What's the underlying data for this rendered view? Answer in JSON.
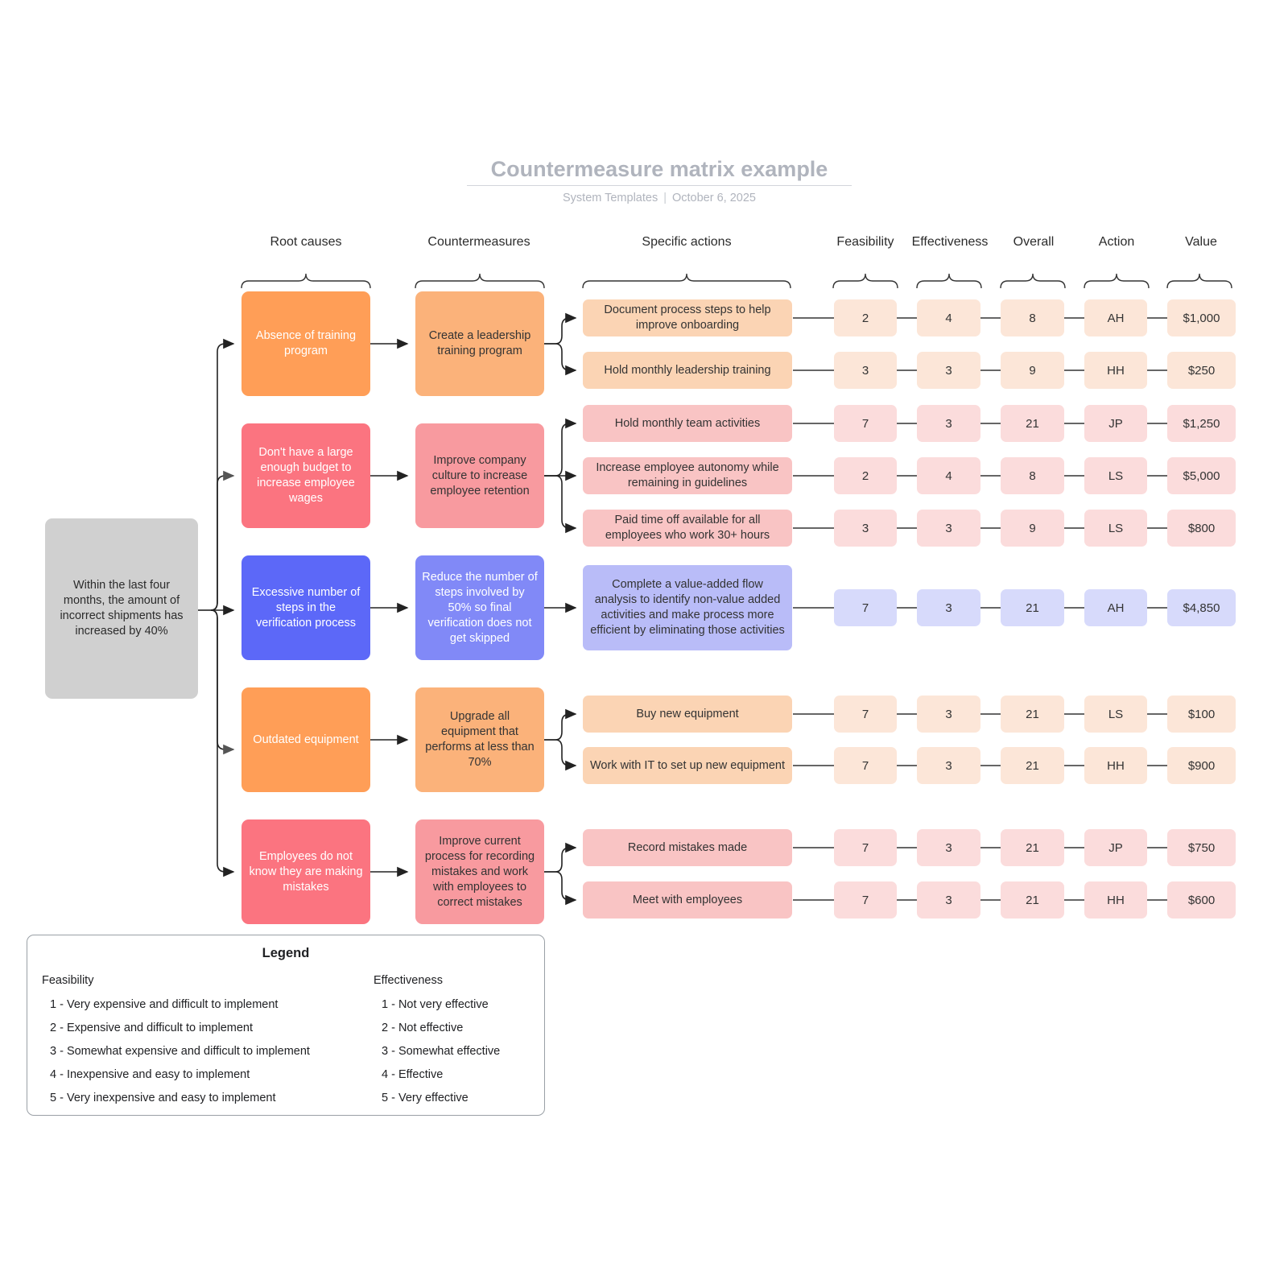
{
  "header": {
    "title": "Countermeasure matrix example",
    "author": "System Templates",
    "separator": "|",
    "date": "October 6, 2025"
  },
  "columns": [
    {
      "key": "root_causes",
      "label": "Root causes"
    },
    {
      "key": "countermeasures",
      "label": "Countermeasures"
    },
    {
      "key": "specific_actions",
      "label": "Specific actions"
    },
    {
      "key": "feasibility",
      "label": "Feasibility"
    },
    {
      "key": "effectiveness",
      "label": "Effectiveness"
    },
    {
      "key": "overall",
      "label": "Overall"
    },
    {
      "key": "action",
      "label": "Action"
    },
    {
      "key": "value",
      "label": "Value"
    }
  ],
  "problem": {
    "text": "Within the last four months, the amount of incorrect shipments has increased by 40%",
    "color": "#d0d0d0"
  },
  "palette": {
    "orange_strong": "#FF9E57",
    "orange_mid": "#FBB27A",
    "orange_light": "#FBD4B4",
    "orange_cell": "#FCE6D8",
    "pink_strong": "#FB7480",
    "pink_mid": "#F89A9F",
    "pink_light": "#F9C4C4",
    "pink_cell": "#FBDCDC",
    "blue_strong": "#5C68F8",
    "blue_mid": "#8189F7",
    "blue_light": "#B9BCF8",
    "blue_cell": "#D7DAFB"
  },
  "groups": [
    {
      "id": "g1",
      "theme": "orange",
      "root_cause": "Absence of training program",
      "countermeasure": "Create a leadership training program",
      "rows": [
        {
          "action": "Document process steps to help improve onboarding",
          "feasibility": "2",
          "effectiveness": "4",
          "overall": "8",
          "owner": "AH",
          "value": "$1,000"
        },
        {
          "action": "Hold monthly leadership training",
          "feasibility": "3",
          "effectiveness": "3",
          "overall": "9",
          "owner": "HH",
          "value": "$250"
        }
      ]
    },
    {
      "id": "g2",
      "theme": "pink",
      "root_cause": "Don't have a large enough budget to increase employee wages",
      "countermeasure": "Improve company culture to increase employee retention",
      "rows": [
        {
          "action": "Hold monthly team activities",
          "feasibility": "7",
          "effectiveness": "3",
          "overall": "21",
          "owner": "JP",
          "value": "$1,250"
        },
        {
          "action": "Increase employee autonomy while remaining in guidelines",
          "feasibility": "2",
          "effectiveness": "4",
          "overall": "8",
          "owner": "LS",
          "value": "$5,000"
        },
        {
          "action": "Paid time off available for all employees who work 30+ hours",
          "feasibility": "3",
          "effectiveness": "3",
          "overall": "9",
          "owner": "LS",
          "value": "$800"
        }
      ]
    },
    {
      "id": "g3",
      "theme": "blue",
      "root_cause": "Excessive number of steps in the verification process",
      "countermeasure": "Reduce the number of steps involved by 50% so final verification does not get skipped",
      "rows": [
        {
          "action": "Complete a value-added flow analysis to identify non-value added activities and make process more efficient by eliminating those activities",
          "feasibility": "7",
          "effectiveness": "3",
          "overall": "21",
          "owner": "AH",
          "value": "$4,850"
        }
      ]
    },
    {
      "id": "g4",
      "theme": "orange",
      "root_cause": "Outdated equipment",
      "countermeasure": "Upgrade all equipment that performs at less than 70%",
      "rows": [
        {
          "action": "Buy new equipment",
          "feasibility": "7",
          "effectiveness": "3",
          "overall": "21",
          "owner": "LS",
          "value": "$100"
        },
        {
          "action": "Work with IT to set up new equipment",
          "feasibility": "7",
          "effectiveness": "3",
          "overall": "21",
          "owner": "HH",
          "value": "$900"
        }
      ]
    },
    {
      "id": "g5",
      "theme": "pink",
      "root_cause": "Employees do not know they are making mistakes",
      "countermeasure": "Improve current process for recording mistakes and work with employees to correct mistakes",
      "rows": [
        {
          "action": "Record mistakes made",
          "feasibility": "7",
          "effectiveness": "3",
          "overall": "21",
          "owner": "JP",
          "value": "$750"
        },
        {
          "action": "Meet with employees",
          "feasibility": "7",
          "effectiveness": "3",
          "overall": "21",
          "owner": "HH",
          "value": "$600"
        }
      ]
    }
  ],
  "legend": {
    "title": "Legend",
    "feasibility": {
      "heading": "Feasibility",
      "items": [
        "1 - Very expensive and difficult to implement",
        "2 - Expensive and difficult to implement",
        "3 - Somewhat expensive and difficult to implement",
        "4 - Inexpensive and easy to implement",
        "5 - Very inexpensive and easy to implement"
      ]
    },
    "effectiveness": {
      "heading": "Effectiveness",
      "items": [
        "1 - Not very effective",
        "2 - Not effective",
        "3 - Somewhat effective",
        "4 - Effective",
        "5 - Very effective"
      ]
    }
  }
}
